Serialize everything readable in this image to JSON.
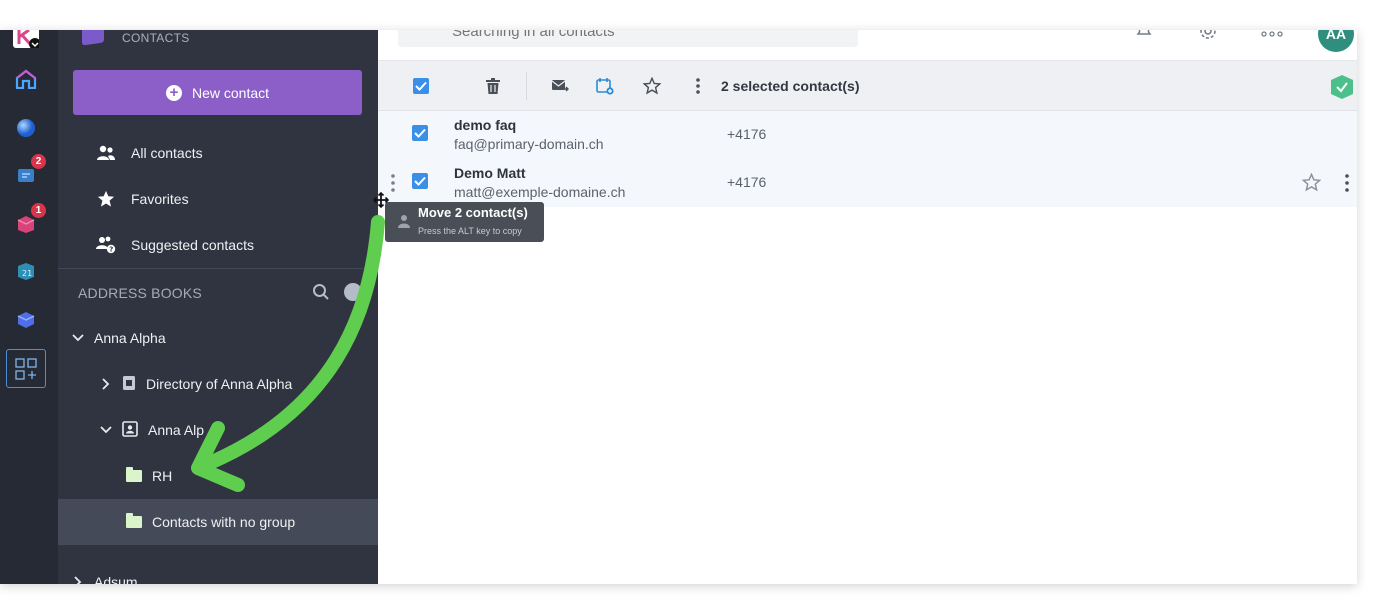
{
  "app": {
    "section_title": "CONTACTS"
  },
  "rail": {
    "badges": [
      "2",
      "1"
    ]
  },
  "sidebar": {
    "new_contact_label": "New contact",
    "nav": [
      {
        "label": "All contacts",
        "icon": "people-icon"
      },
      {
        "label": "Favorites",
        "icon": "star-icon"
      },
      {
        "label": "Suggested contacts",
        "icon": "suggested-people-icon"
      }
    ],
    "address_books_label": "ADDRESS BOOKS",
    "tree": {
      "owner": "Anna Alpha",
      "directory": "Directory of Anna Alpha",
      "book": "Anna Alp",
      "group_rh": "RH",
      "no_group": "Contacts with no group",
      "other_owner": "Adsum"
    }
  },
  "topbar": {
    "search_placeholder": "Searching in all contacts",
    "avatar_initials": "AA"
  },
  "toolbar": {
    "selected_text": "2 selected contact(s)"
  },
  "contacts": [
    {
      "name": "demo faq",
      "email": "faq@primary-domain.ch",
      "phone": "+4176"
    },
    {
      "name": "Demo Matt",
      "email": "matt@exemple-domaine.ch",
      "phone": "+4176"
    }
  ],
  "drag_tooltip": {
    "title": "Move 2 contact(s)",
    "hint": "Press the ALT key to copy"
  },
  "colors": {
    "accent": "#8b5fc7",
    "checkbox": "#3b8fe6",
    "arrow": "#5fce4e"
  }
}
